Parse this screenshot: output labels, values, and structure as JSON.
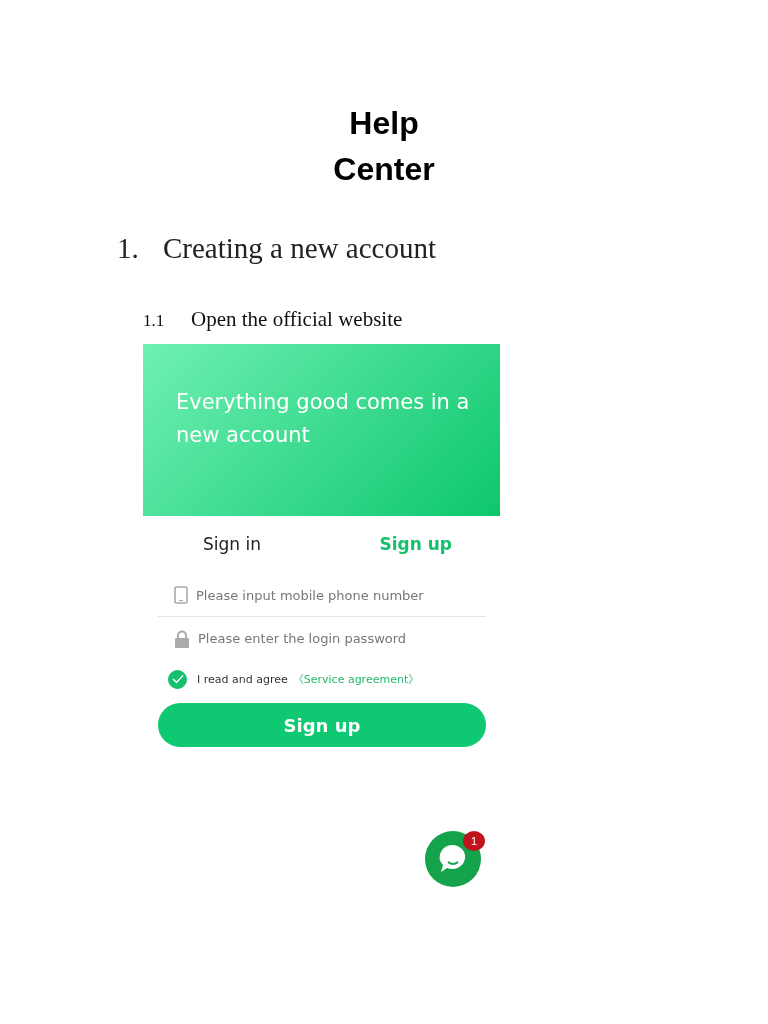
{
  "title": "Help Center",
  "section": {
    "number": "1.",
    "title": "Creating a new account"
  },
  "subsection": {
    "number": "1.1",
    "title": "Open the official website"
  },
  "signup": {
    "banner_text": "Everything good comes in a new account",
    "tabs": [
      {
        "label": "Sign in",
        "selected": false
      },
      {
        "label": "Sign up",
        "selected": true
      }
    ],
    "fields": [
      {
        "kind": "phone",
        "placeholder": "Please input mobile phone number"
      },
      {
        "kind": "password",
        "placeholder": "Please enter the login password"
      }
    ],
    "agreement": {
      "checked": true,
      "text": "I read and agree",
      "link": "《Service agreement》"
    },
    "button": "Sign up"
  },
  "chat": {
    "badge": "1"
  }
}
